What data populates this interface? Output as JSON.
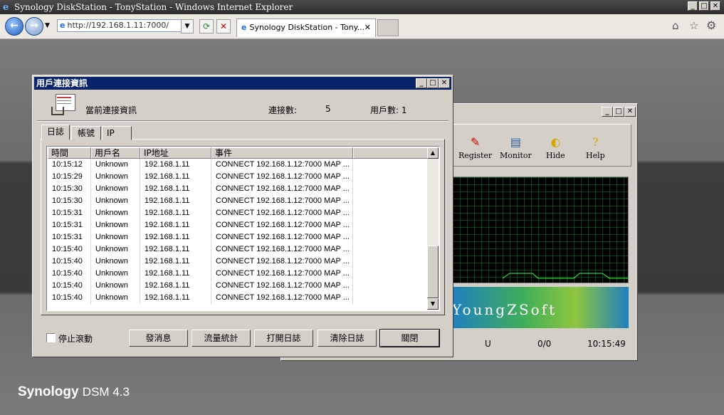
{
  "browser": {
    "window_title": "Synology DiskStation - TonyStation - Windows Internet Explorer",
    "address": "http://192.168.1.11:7000/",
    "tab_title": "Synology DiskStation - Tony...",
    "tab_close": "✕"
  },
  "desktop": {
    "brand": "Synology",
    "product": "DSM 4.3"
  },
  "back_window": {
    "toolbar": [
      "Register",
      "Monitor",
      "Hide",
      "Help"
    ],
    "banner_text": "YoungZSoft",
    "status": {
      "col1": "U",
      "col2": "0/0",
      "time": "10:15:49"
    }
  },
  "dialog": {
    "title": "用戶連接資訊",
    "heading": "當前連接資訊",
    "connections_label": "連接數:",
    "connections_value": "5",
    "users_label": "用戶數: 1",
    "tabs": [
      "日誌",
      "帳號",
      "IP"
    ],
    "columns": [
      "時間",
      "用戶名",
      "IP地址",
      "事件"
    ],
    "rows": [
      [
        "10:15:12",
        "Unknown",
        "192.168.1.11",
        "CONNECT 192.168.1.12:7000 MAP ..."
      ],
      [
        "10:15:29",
        "Unknown",
        "192.168.1.11",
        "CONNECT 192.168.1.12:7000 MAP ..."
      ],
      [
        "10:15:30",
        "Unknown",
        "192.168.1.11",
        "CONNECT 192.168.1.12:7000 MAP ..."
      ],
      [
        "10:15:30",
        "Unknown",
        "192.168.1.11",
        "CONNECT 192.168.1.12:7000 MAP ..."
      ],
      [
        "10:15:31",
        "Unknown",
        "192.168.1.11",
        "CONNECT 192.168.1.12:7000 MAP ..."
      ],
      [
        "10:15:31",
        "Unknown",
        "192.168.1.11",
        "CONNECT 192.168.1.12:7000 MAP ..."
      ],
      [
        "10:15:31",
        "Unknown",
        "192.168.1.11",
        "CONNECT 192.168.1.12:7000 MAP ..."
      ],
      [
        "10:15:40",
        "Unknown",
        "192.168.1.11",
        "CONNECT 192.168.1.12:7000 MAP ..."
      ],
      [
        "10:15:40",
        "Unknown",
        "192.168.1.11",
        "CONNECT 192.168.1.12:7000 MAP ..."
      ],
      [
        "10:15:40",
        "Unknown",
        "192.168.1.11",
        "CONNECT 192.168.1.12:7000 MAP ..."
      ],
      [
        "10:15:40",
        "Unknown",
        "192.168.1.11",
        "CONNECT 192.168.1.12:7000 MAP ..."
      ],
      [
        "10:15:40",
        "Unknown",
        "192.168.1.11",
        "CONNECT 192.168.1.12:7000 MAP ..."
      ]
    ],
    "stop_scroll_label": "停止滾動",
    "buttons": [
      "發消息",
      "流量統計",
      "打開日誌",
      "清除日誌",
      "關閉"
    ]
  }
}
